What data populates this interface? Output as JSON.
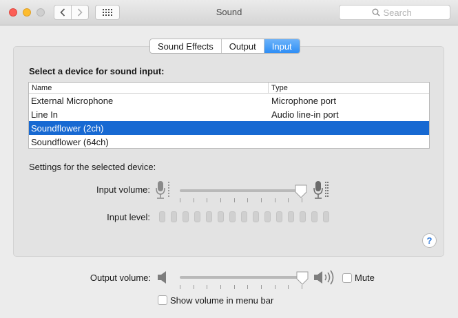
{
  "window": {
    "title": "Sound"
  },
  "toolbar": {
    "search_placeholder": "Search"
  },
  "tabs": [
    {
      "label": "Sound Effects",
      "active": false
    },
    {
      "label": "Output",
      "active": false
    },
    {
      "label": "Input",
      "active": true
    }
  ],
  "input": {
    "section_title": "Select a device for sound input:",
    "columns": [
      "Name",
      "Type"
    ],
    "devices": [
      {
        "name": "External Microphone",
        "type": "Microphone port",
        "selected": false
      },
      {
        "name": "Line In",
        "type": "Audio line-in port",
        "selected": false
      },
      {
        "name": "Soundflower (2ch)",
        "type": "",
        "selected": true
      },
      {
        "name": "Soundflower (64ch)",
        "type": "",
        "selected": false
      }
    ],
    "settings_label": "Settings for the selected device:",
    "input_volume_label": "Input volume:",
    "input_volume_fraction": 0.99,
    "input_level_label": "Input level:",
    "input_level_cells": 15
  },
  "help_label": "?",
  "output": {
    "volume_label": "Output volume:",
    "volume_fraction": 1.0,
    "mute_label": "Mute",
    "mute_checked": false,
    "show_in_menubar_label": "Show volume in menu bar",
    "show_in_menubar_checked": false
  },
  "colors": {
    "selection": "#1769d2",
    "active_tab": "#2e8ef5",
    "close": "#fc5f57",
    "minimize": "#fdbc2e"
  }
}
